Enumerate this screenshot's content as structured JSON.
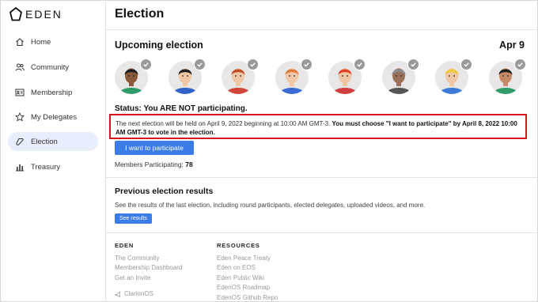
{
  "brand": {
    "name": "EDEN"
  },
  "sidebar": {
    "items": [
      {
        "label": "Home",
        "icon": "home-icon"
      },
      {
        "label": "Community",
        "icon": "users-icon"
      },
      {
        "label": "Membership",
        "icon": "id-card-icon"
      },
      {
        "label": "My Delegates",
        "icon": "star-icon"
      },
      {
        "label": "Election",
        "icon": "election-icon",
        "active": true
      },
      {
        "label": "Treasury",
        "icon": "bar-chart-icon"
      }
    ]
  },
  "main": {
    "title": "Election",
    "upcoming": {
      "title": "Upcoming election",
      "date": "Apr 9",
      "status": "Status: You ARE NOT participating.",
      "notice_plain": "The next election will be held on April 9, 2022 beginning at 10:00 AM GMT-3. ",
      "notice_bold": "You must choose \"I want to participate\" by April 8, 2022 10:00 AM GMT-3 to vote in the election.",
      "participate_label": "I want to participate",
      "members_label": "Members Participating: ",
      "members_count": "78"
    },
    "previous": {
      "title": "Previous election results",
      "description": "See the results of the last election, including round participants, elected delegates, uploaded videos, and more.",
      "button_label": "See results"
    }
  },
  "avatar_colors": [
    {
      "skin": "#8a5a3b",
      "hair": "#1e1e1e",
      "shirt": "#2f9c6a"
    },
    {
      "skin": "#f0c6a4",
      "hair": "#1e1e1e",
      "shirt": "#3062c8"
    },
    {
      "skin": "#f0c6a4",
      "hair": "#c0502a",
      "shirt": "#d1453a"
    },
    {
      "skin": "#f0c6a4",
      "hair": "#e07a3a",
      "shirt": "#3c6bd6"
    },
    {
      "skin": "#f0c6a4",
      "hair": "#e0402a",
      "shirt": "#d13e3e"
    },
    {
      "skin": "#9a7058",
      "hair": "#8c8c8c",
      "shirt": "#555555"
    },
    {
      "skin": "#f0c6a4",
      "hair": "#f0c93a",
      "shirt": "#3b7ad6"
    },
    {
      "skin": "#c58b68",
      "hair": "#1e1e1e",
      "shirt": "#2f9c6a"
    }
  ],
  "footer": {
    "eden": {
      "heading": "EDEN",
      "links": [
        "The Community",
        "Membership Dashboard",
        "Get an Invite"
      ]
    },
    "resources": {
      "heading": "RESOURCES",
      "links": [
        "Eden Peace Treaty",
        "Eden on EOS",
        "Eden Public Wiki",
        "EdenOS Roadmap",
        "EdenOS Github Repo"
      ]
    },
    "clarion": "ClarionOS"
  },
  "colors": {
    "accent": "#3c7ce9",
    "highlight_border": "#d8151c",
    "active_nav": "#e8eefb"
  }
}
